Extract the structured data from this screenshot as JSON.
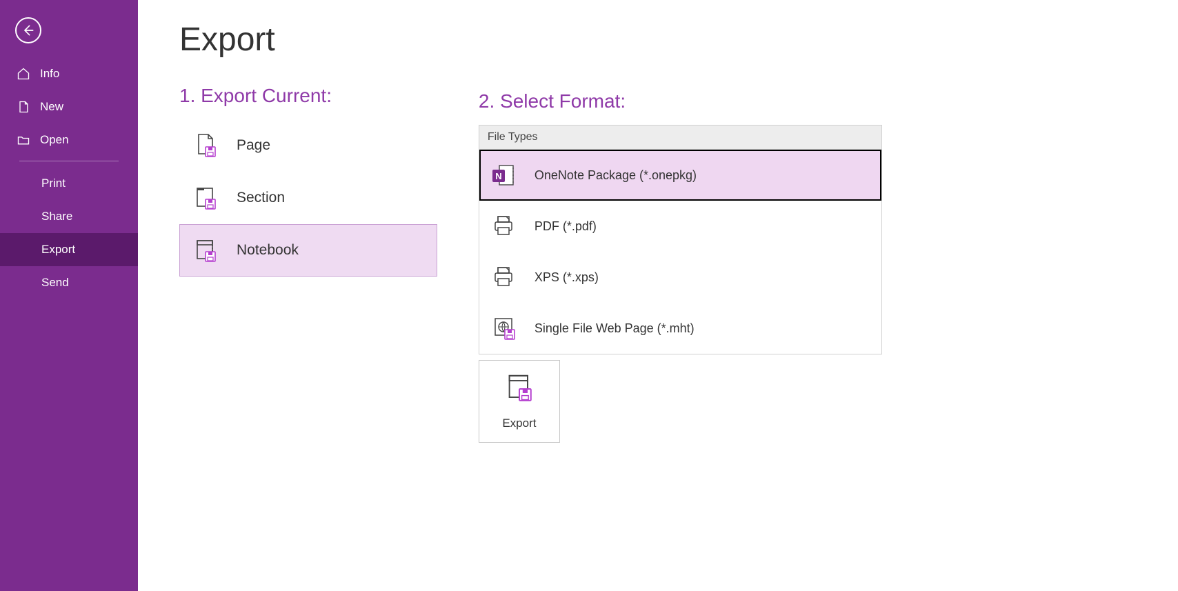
{
  "sidebar": {
    "back": "Back",
    "items": [
      {
        "label": "Info"
      },
      {
        "label": "New"
      },
      {
        "label": "Open"
      }
    ],
    "subitems": [
      {
        "label": "Print",
        "active": false
      },
      {
        "label": "Share",
        "active": false
      },
      {
        "label": "Export",
        "active": true
      },
      {
        "label": "Send",
        "active": false
      }
    ]
  },
  "main": {
    "title": "Export",
    "section1": {
      "heading": "1. Export Current:",
      "options": [
        {
          "label": "Page",
          "selected": false
        },
        {
          "label": "Section",
          "selected": false
        },
        {
          "label": "Notebook",
          "selected": true
        }
      ]
    },
    "section2": {
      "heading": "2. Select Format:",
      "group_label": "File Types",
      "formats": [
        {
          "label": "OneNote Package (*.onepkg)",
          "selected": true
        },
        {
          "label": "PDF (*.pdf)",
          "selected": false
        },
        {
          "label": "XPS (*.xps)",
          "selected": false
        },
        {
          "label": "Single File Web Page (*.mht)",
          "selected": false
        }
      ],
      "export_button": "Export"
    }
  }
}
